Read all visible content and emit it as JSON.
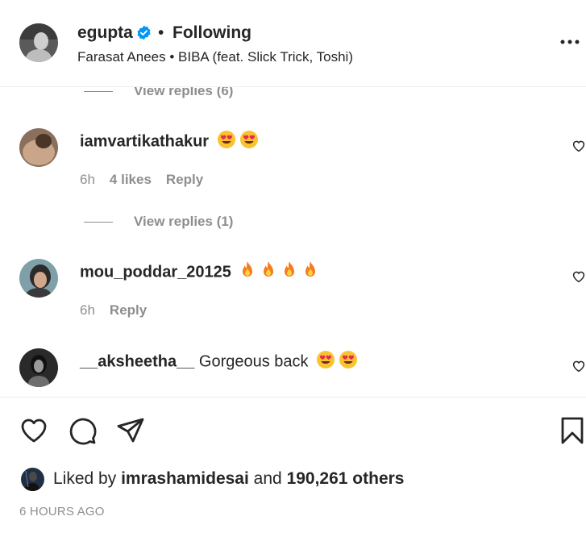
{
  "post_header": {
    "username": "egupta",
    "separator": "•",
    "follow_status": "Following",
    "audio": "Farasat Anees • BIBA (feat. Slick Trick, Toshi)"
  },
  "comments": {
    "top_view_replies": "View replies (6)",
    "items": [
      {
        "username": "iamvartikathakur",
        "text": "",
        "emojis": [
          "heart-eyes-emoji",
          "heart-eyes-emoji"
        ],
        "time": "6h",
        "likes": "4 likes",
        "reply_label": "Reply",
        "view_replies": "View replies (1)"
      },
      {
        "username": "mou_poddar_20125",
        "text": "",
        "emojis": [
          "fire-emoji",
          "fire-emoji",
          "fire-emoji",
          "fire-emoji"
        ],
        "time": "6h",
        "reply_label": "Reply"
      },
      {
        "username": "__aksheetha__",
        "text": "Gorgeous back",
        "emojis": [
          "heart-eyes-emoji",
          "heart-eyes-emoji"
        ]
      }
    ]
  },
  "actions": {
    "icons": [
      "heart-icon",
      "comment-icon",
      "share-icon",
      "bookmark-icon"
    ]
  },
  "likes_summary": {
    "prefix": "Liked by",
    "user": "imrashamidesai",
    "connector": "and",
    "others": "190,261 others"
  },
  "timestamp": "6 HOURS AGO",
  "colors": {
    "text": "#262626",
    "secondary": "#8e8e8e",
    "verified": "#0095f6",
    "divider": "#efefef"
  }
}
